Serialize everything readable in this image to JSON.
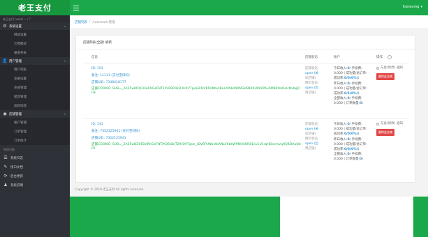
{
  "header": {
    "logo": "老王支付",
    "user_name": "Itoneomg",
    "user_caret": "▾"
  },
  "sidebar": {
    "user_info": "老王支付 (user) ✓ / ?",
    "groups": [
      {
        "label": "系统设置",
        "icon": "gear-icon",
        "items": [
          "网站设置",
          "计费模式",
          "通道开关"
        ]
      },
      {
        "label": "用户管理",
        "icon": "user-icon",
        "items": [
          "用户列表",
          "注册设置",
          "充值管理",
          "提现管理",
          "加款扣款"
        ]
      },
      {
        "label": "店铺管理",
        "icon": "shop-icon",
        "items": [
          "账户管理",
          "订单管理",
          "订单统计"
        ]
      }
    ],
    "section_label": "系统功能",
    "bottom_items": [
      {
        "label": "系统日志",
        "icon": "log-icon"
      },
      {
        "label": "接口文档",
        "icon": "doc-icon"
      },
      {
        "label": "后台更新",
        "icon": "update-icon"
      },
      {
        "label": "系统说明",
        "icon": "info-icon"
      }
    ]
  },
  "breadcrumb": {
    "home": "店铺列表",
    "sep": "/",
    "current": "Automatic管理"
  },
  "panel": {
    "title": "店铺列表(全部) 刷新",
    "columns": {
      "info": "信息",
      "status": "店铺状态",
      "money": "账户",
      "ops": "操作"
    }
  },
  "rows": [
    {
      "id": "ID: 153",
      "note": "备注: 11111 (支付宝扫码)",
      "uid": "店铺UID: 7348418177",
      "cookie": "店铺COOKIE: SUB=_2A25wKOQ1DeRhGeFNT1zV89FNzD-IHXVTgoLBrDV6PUNbvtBeLXX9kW9NGk6NRKUPk9P6u5M89YedHerNvbgDHE",
      "status": [
        "店铺状态:",
        "open (关",
        "闭店铺)",
        "网页状态:",
        "open (启",
        "用店铺)"
      ],
      "money": [
        {
          "label": "今日收入:",
          "val": "0",
          "tail": "/ 手续费:"
        },
        {
          "label": "0.000 ( 成功量/总订单:",
          "val": "",
          "tail": ""
        },
        {
          "label": "成功率:",
          "val": "0/0(0%)",
          "tail": ")"
        },
        {
          "label": "昨日收入:",
          "val": "0",
          "tail": "/ 手续费:"
        },
        {
          "label": "0.000 ( 成功量/总订单:",
          "val": "",
          "tail": ""
        },
        {
          "label": "成功率:",
          "val": "0/1(0%)",
          "tail": ")"
        },
        {
          "label": "全部收入:",
          "val": "0",
          "tail": "/ 手续费:"
        },
        {
          "label": "0.000 ( 订单数量:",
          "val": "0",
          "tail": ")"
        }
      ],
      "op_check": "与此(修改) 通知",
      "op_button": "删除此店铺"
    },
    {
      "id": "ID: 141",
      "note": "备注: 7352125941 (支付宝扫码)",
      "uid": "店铺UID: 7352125941",
      "cookie": "店铺COOKIE: SUB=_2A25wBZ65DeRhGeFNTIAQ6i8zjT29rDVTgve_rDV6PUNbvtbANLV6bkW9NQARR81ilu1U1rqHBoemvqHQ4DAaQbDI",
      "status": [
        "店铺状态:",
        "open (关",
        "闭店铺)",
        "网页状态:",
        "open (启",
        "用店铺)"
      ],
      "money": [
        {
          "label": "今日收入:",
          "val": "0",
          "tail": "/ 手续费:"
        },
        {
          "label": "0.000 ( 成功量/总订单:",
          "val": "",
          "tail": ""
        },
        {
          "label": "成功率:",
          "val": "0/0(0%)",
          "tail": ")"
        },
        {
          "label": "昨日收入:",
          "val": "0",
          "tail": "/ 手续费:"
        },
        {
          "label": "0.000 ( 成功量/总订单:",
          "val": "",
          "tail": ""
        },
        {
          "label": "成功率:",
          "val": "0/0(0%)",
          "tail": ")"
        },
        {
          "label": "全部收入:",
          "val": "0",
          "tail": "/ 手续费:"
        },
        {
          "label": "0.000 ( 订单数量:",
          "val": "0",
          "tail": ")"
        }
      ],
      "op_check": "与此(修改) 通知",
      "op_button": "删除此店铺"
    }
  ],
  "footer": {
    "copyright": "Copyright © 2018 老王支付 All rights reserved."
  }
}
